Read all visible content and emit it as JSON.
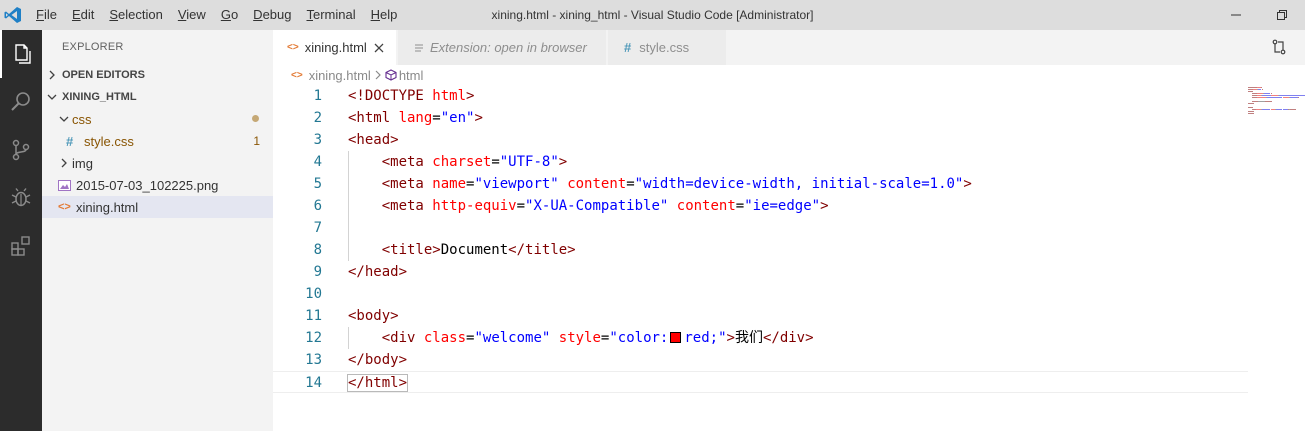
{
  "window": {
    "title": "xining.html - xining_html - Visual Studio Code [Administrator]"
  },
  "menu": [
    {
      "hotkey": "F",
      "rest": "ile"
    },
    {
      "hotkey": "E",
      "rest": "dit"
    },
    {
      "hotkey": "S",
      "rest": "election"
    },
    {
      "hotkey": "V",
      "rest": "iew"
    },
    {
      "hotkey": "G",
      "rest": "o"
    },
    {
      "hotkey": "D",
      "rest": "ebug"
    },
    {
      "hotkey": "T",
      "rest": "erminal"
    },
    {
      "hotkey": "H",
      "rest": "elp"
    }
  ],
  "sidebar": {
    "title": "EXPLORER",
    "open_editors": "OPEN EDITORS",
    "workspace": "XINING_HTML",
    "tree": {
      "css_folder": "css",
      "style_file": "style.css",
      "style_problems": "1",
      "img_folder": "img",
      "png_file": "2015-07-03_102225.png",
      "html_file": "xining.html"
    }
  },
  "tabs": [
    {
      "label": "xining.html",
      "state": "active"
    },
    {
      "label": "Extension: open in browser",
      "state": "preview"
    },
    {
      "label": "style.css",
      "state": "inactive"
    }
  ],
  "breadcrumb": {
    "file": "xining.html",
    "symbol": "html"
  },
  "editor": {
    "lines": [
      [
        [
          "t",
          "<!DOCTYPE "
        ],
        [
          "a",
          "html"
        ],
        [
          "t",
          ">"
        ]
      ],
      [
        [
          "t",
          "<html "
        ],
        [
          "a",
          "lang"
        ],
        [
          "c",
          "="
        ],
        [
          "v",
          "\"en\""
        ],
        [
          "t",
          ">"
        ]
      ],
      [
        [
          "t",
          "<head>"
        ]
      ],
      [
        [
          "c",
          "    "
        ],
        [
          "t",
          "<meta "
        ],
        [
          "a",
          "charset"
        ],
        [
          "c",
          "="
        ],
        [
          "v",
          "\"UTF-8\""
        ],
        [
          "t",
          ">"
        ]
      ],
      [
        [
          "c",
          "    "
        ],
        [
          "t",
          "<meta "
        ],
        [
          "a",
          "name"
        ],
        [
          "c",
          "="
        ],
        [
          "v",
          "\"viewport\""
        ],
        [
          "c",
          " "
        ],
        [
          "a",
          "content"
        ],
        [
          "c",
          "="
        ],
        [
          "v",
          "\"width=device-width, initial-scale=1.0\""
        ],
        [
          "t",
          ">"
        ]
      ],
      [
        [
          "c",
          "    "
        ],
        [
          "t",
          "<meta "
        ],
        [
          "a",
          "http-equiv"
        ],
        [
          "c",
          "="
        ],
        [
          "v",
          "\"X-UA-Compatible\""
        ],
        [
          "c",
          " "
        ],
        [
          "a",
          "content"
        ],
        [
          "c",
          "="
        ],
        [
          "v",
          "\"ie=edge\""
        ],
        [
          "t",
          ">"
        ]
      ],
      [],
      [
        [
          "c",
          "    "
        ],
        [
          "t",
          "<title>"
        ],
        [
          "c",
          "Document"
        ],
        [
          "t",
          "</title>"
        ]
      ],
      [
        [
          "t",
          "</head>"
        ]
      ],
      [],
      [
        [
          "t",
          "<body>"
        ]
      ],
      [
        [
          "c",
          "    "
        ],
        [
          "t",
          "<div "
        ],
        [
          "a",
          "class"
        ],
        [
          "c",
          "="
        ],
        [
          "v",
          "\"welcome\""
        ],
        [
          "c",
          " "
        ],
        [
          "a",
          "style"
        ],
        [
          "c",
          "="
        ],
        [
          "v",
          "\"color:"
        ],
        [
          "swatch",
          ""
        ],
        [
          "v",
          "red;\""
        ],
        [
          "t",
          ">"
        ],
        [
          "c",
          "我们"
        ],
        [
          "t",
          "</div>"
        ]
      ],
      [
        [
          "t",
          "</body>"
        ]
      ],
      [
        [
          "t",
          "</html>"
        ]
      ]
    ],
    "swatch_color": "#ff0000"
  },
  "colors": {
    "tag": "#800000",
    "attribute": "#ff0000",
    "value": "#0000ff",
    "line_number": "#237893",
    "activity_bar": "#2c2c2c",
    "accent": "#007acc"
  }
}
